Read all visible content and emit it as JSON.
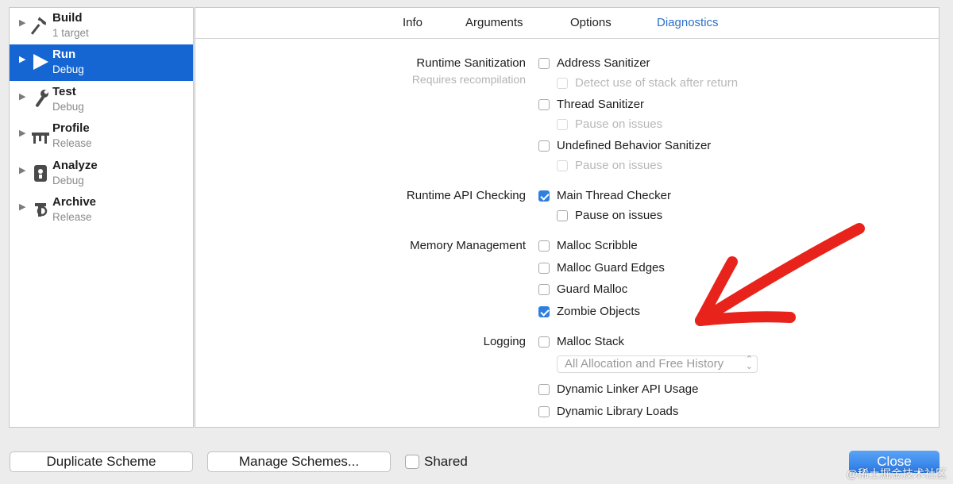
{
  "sidebar": {
    "items": [
      {
        "name": "Build",
        "sub": "1 target",
        "icon": "hammer-icon",
        "selected": false
      },
      {
        "name": "Run",
        "sub": "Debug",
        "icon": "play-icon",
        "selected": true
      },
      {
        "name": "Test",
        "sub": "Debug",
        "icon": "wrench-icon",
        "selected": false
      },
      {
        "name": "Profile",
        "sub": "Release",
        "icon": "gauge-icon",
        "selected": false
      },
      {
        "name": "Analyze",
        "sub": "Debug",
        "icon": "analyze-icon",
        "selected": false
      },
      {
        "name": "Archive",
        "sub": "Release",
        "icon": "archive-icon",
        "selected": false
      }
    ]
  },
  "tabs": [
    "Info",
    "Arguments",
    "Options",
    "Diagnostics"
  ],
  "active_tab": "Diagnostics",
  "sections": {
    "runtime_sanitization": {
      "label": "Runtime Sanitization",
      "note": "Requires recompilation",
      "address_sanitizer": {
        "label": "Address Sanitizer",
        "checked": false
      },
      "detect_stack_after_return": {
        "label": "Detect use of stack after return",
        "checked": false,
        "enabled": false
      },
      "thread_sanitizer": {
        "label": "Thread Sanitizer",
        "checked": false
      },
      "thread_pause": {
        "label": "Pause on issues",
        "checked": false,
        "enabled": false
      },
      "ub_sanitizer": {
        "label": "Undefined Behavior Sanitizer",
        "checked": false
      },
      "ub_pause": {
        "label": "Pause on issues",
        "checked": false,
        "enabled": false
      }
    },
    "runtime_api": {
      "label": "Runtime API Checking",
      "main_thread_checker": {
        "label": "Main Thread Checker",
        "checked": true
      },
      "mtc_pause": {
        "label": "Pause on issues",
        "checked": false,
        "enabled": true
      }
    },
    "memory": {
      "label": "Memory Management",
      "malloc_scribble": {
        "label": "Malloc Scribble",
        "checked": false
      },
      "malloc_guard_edges": {
        "label": "Malloc Guard Edges",
        "checked": false
      },
      "guard_malloc": {
        "label": "Guard Malloc",
        "checked": false
      },
      "zombie_objects": {
        "label": "Zombie Objects",
        "checked": true
      }
    },
    "logging": {
      "label": "Logging",
      "malloc_stack": {
        "label": "Malloc Stack",
        "checked": false
      },
      "malloc_stack_option": "All Allocation and Free History",
      "dyld_api": {
        "label": "Dynamic Linker API Usage",
        "checked": false
      },
      "dyld_loads": {
        "label": "Dynamic Library Loads",
        "checked": false
      }
    }
  },
  "footer": {
    "duplicate": "Duplicate Scheme",
    "manage": "Manage Schemes...",
    "shared": "Shared",
    "close": "Close",
    "watermark": "@稀土掘金技术社区"
  },
  "colors": {
    "accent": "#1566d3",
    "annotation": "#e8231b",
    "tab_active": "#2b6fc8"
  }
}
